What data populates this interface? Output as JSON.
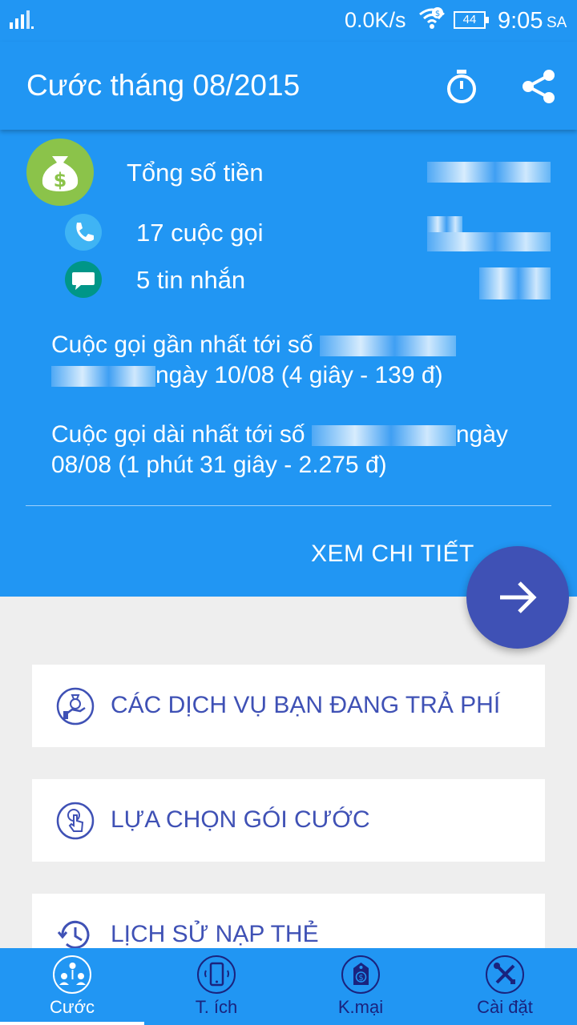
{
  "status_bar": {
    "network_speed": "0.0K/s",
    "battery_level": "44",
    "time": "9:05",
    "am_pm": "SA"
  },
  "app_bar": {
    "title": "Cước tháng 08/2015",
    "actions": [
      "timer-icon",
      "share-icon"
    ]
  },
  "summary": {
    "total_label": "Tổng số tiền",
    "calls_label": "17 cuộc gọi",
    "messages_label": "5 tin nhắn",
    "latest_call_prefix": "Cuộc gọi gần nhất  tới số",
    "latest_call_suffix": "ngày 10/08 (4 giây - 139 đ)",
    "longest_call_prefix": "Cuộc gọi dài nhất  tới số",
    "longest_call_suffix": "ngày 08/08 (1 phút 31 giây - 2.275 đ)",
    "detail_button": "XEM CHI TIẾT"
  },
  "cards": [
    {
      "label": "CÁC DỊCH VỤ BẠN ĐANG TRẢ PHÍ",
      "icon": "money-hand-icon"
    },
    {
      "label": "LỰA CHỌN GÓI CƯỚC",
      "icon": "touch-icon"
    },
    {
      "label": "LỊCH SỬ NẠP THẺ",
      "icon": "history-icon"
    }
  ],
  "bottom_nav": [
    {
      "label": "Cước",
      "icon": "people-icon",
      "active": true
    },
    {
      "label": "T. ích",
      "icon": "phone-icon",
      "active": false
    },
    {
      "label": "K.mại",
      "icon": "tag-icon",
      "active": false
    },
    {
      "label": "Cài đặt",
      "icon": "tools-icon",
      "active": false
    }
  ],
  "colors": {
    "primary": "#2196f3",
    "accent": "#3f51b5",
    "nav_inactive": "#1a237e",
    "money_icon_bg": "#8bc34a"
  }
}
